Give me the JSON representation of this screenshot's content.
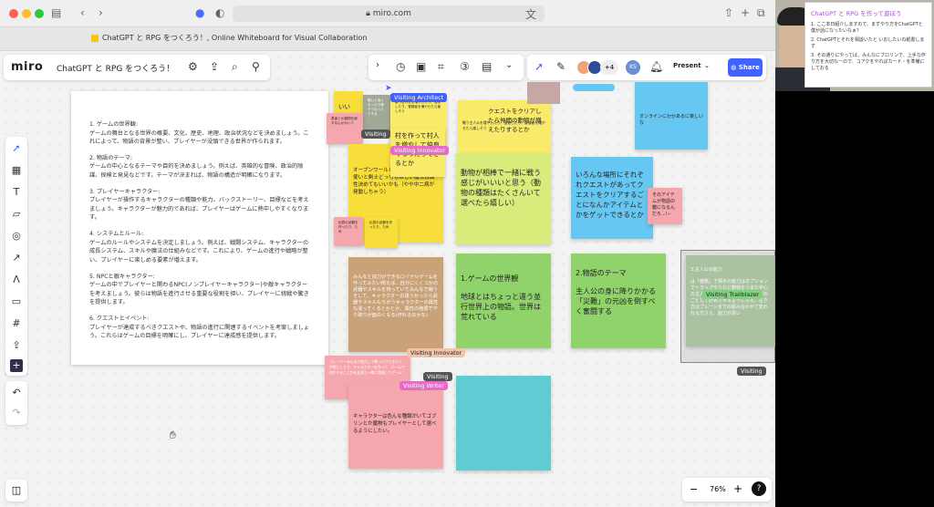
{
  "browser": {
    "url": "miro.com",
    "tab_title": "ChatGPT と RPG をつくろう！, Online Whiteboard for Visual Collaboration"
  },
  "app": {
    "logo": "miro",
    "board_title": "ChatGPT と RPG をつくろう！",
    "present_label": "Present",
    "share_label": "Share",
    "collaborator_count": "+4",
    "zoom_level": "76%"
  },
  "document": {
    "sections": [
      {
        "title": "1. ゲームの世界観:",
        "body": "ゲームの舞台となる世界の概要、文化、歴史、地理、政治状況などを決めましょう。これによって、物語の背景が整い、プレイヤーが没頭できる世界が作られます。"
      },
      {
        "title": "2. 物語のテーマ:",
        "body": "ゲームの中心となるテーマや目的を決めましょう。例えば、英雄的な冒険、政治的陰謀、探検と発見などです。テーマが決まれば、物語の構造が明確になります。"
      },
      {
        "title": "3. プレイヤーキャラクター:",
        "body": "プレイヤーが操作するキャラクターの種類や能力、バックストーリー、目標などを考えましょう。キャラクターが魅力的であれば、プレイヤーはゲームに熱中しやすくなります。"
      },
      {
        "title": "4. システムとルール:",
        "body": "ゲームのルールやシステムを決定しましょう。例えば、戦闘システム、キャラクターの成長システム、スキルや魔法の仕組みなどです。これにより、ゲームの進行や戦略が整い、プレイヤーに楽しめる要素が増えます。"
      },
      {
        "title": "5. NPCと敵キャラクター:",
        "body": "ゲームの中でプレイヤーと関わるNPC(ノンプレイヤーキャラクター)や敵キャラクターを考えましょう。彼らは物語を進行させる重要な役割を担い、プレイヤーに挑戦や驚きを提供します。"
      },
      {
        "title": "6. クエストとイベント:",
        "body": "プレイヤーが達成するべきクエストや、物語の進行に関連するイベントを考案しましょう。これらはゲームの目標を明確にし、プレイヤーに達成感を提供します。"
      }
    ]
  },
  "stickies": {
    "iine": "いいね！",
    "gray_small": "戦いと強くなったり悪そうなったりする",
    "mura": "村を作って村人を増やして仲良くなったりできるとか",
    "cursor_pop": "がもらえるとか",
    "quest_fix": "クエストをクリアしたら仲間の動物が増えたりするとか",
    "small_left": "戦う主人公を増やしたり、強化したり、冒険者を増やせたら楽しそう",
    "open_world": "オープンワールドががいいなぁ♪魔法使いと剣士どっちもほしい魔法は属性決めてもいいかも（やや中二病が発動しちゃう）",
    "animals": "動物が相棒で一緒に戦う感じがいいいと思う（動物の種類はたくさんいて選べたら嬉しい）",
    "places": "いろんな場所にそれぞれクエストがあってクエストをクリアするごとになんかアイテムとかをゲットできるとか",
    "item": "そのアイテムが物語の鍵になるんだろ…!--",
    "online": "オンラインにかかあるに楽しいな",
    "pink_a": "勇者とか魔物を倒すなんかかいて",
    "pink_b": "伝説の武器を作ったり、ため",
    "tan": "みんなと協力ができるロイヤルゲームを作ってみたい例えば、自分にくくつかの武器やスキルを持っていてみんなで戦うそして、キャラクターの違うかったら武器やスキルもちがうキャラクターの属性も違ってくるとかとか、属性の強弱でやり取りが面白くなる(作れるのかな)",
    "world": "1.ゲームの世界観\n\n地球とはちょっと違う並行世界上の物語。世界は荒れている",
    "theme": "2.物語のテーマ\n\n主人公の身に降りかかる「災難」の元凶を倒すべく奮闘する",
    "hero": "3.主人公の能力\n\nは「魔獣」で相手の能力はオプションでトラップやうなど動物をつまた中心の主人の人は特異的能力を使う事がのごとして計算させるようになる。在り方はプレーンまでの組み合わせて変われる方さえ、能力が高い",
    "pink_c": "プレーヤーみんなで協力して戦ったりできたら、仲間にしたり、キャラクターを作って…チームで何かすることかを友達と一緒に冒険してゲーム",
    "pink_d": "キャラクターは色んな種類がいてゴブリンとか魔物もプレイヤーとして選べるようにしたい。"
  },
  "cursors": {
    "architect": "Visiting Architect",
    "innovator_top": "Visiting Innovator",
    "innovator_bottom": "Visiting Innovator",
    "visiting_a": "Visiting",
    "visiting_b": "Visiting",
    "visiting_c": "Visiting",
    "writer": "Visiting Writer",
    "trailblazer": "Visiting Trailblazer"
  },
  "video": {
    "slide_title": "ChatGPT と RPG を作って遊ぼう",
    "slide_lines": [
      "1. ここ本日紹介しますので、まずやり方をChatGPTと僕が話になったいなぁ？",
      "2. ChatGPTとそれを相談いたと いおしたいの紙書します",
      "3. その通りにやってば、みんなにブロリンで、上手な作り方を大切なーので、コアクをやればカード・を準備にしておる"
    ]
  },
  "colors": {
    "accent": "#4262ff",
    "sticky_yellow": "#f7de3b",
    "sticky_green": "#c5df5b",
    "sticky_blue": "#67c7f3",
    "sticky_pink": "#f6a7ad"
  }
}
